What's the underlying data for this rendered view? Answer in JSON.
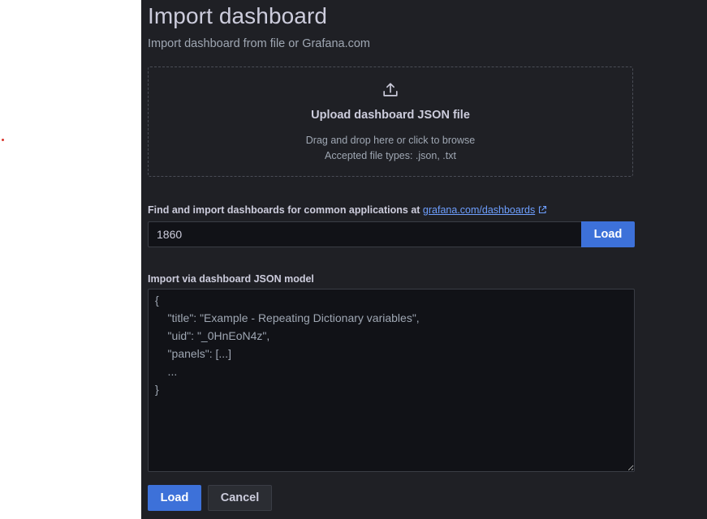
{
  "page": {
    "title": "Import dashboard",
    "subtitle": "Import dashboard from file or Grafana.com"
  },
  "upload": {
    "icon": "upload-icon",
    "title": "Upload dashboard JSON file",
    "hint": "Drag and drop here or click to browse",
    "accepted_types": "Accepted file types: .json, .txt"
  },
  "grafana_com": {
    "label": "Find and import dashboards for common applications at ",
    "link_text": "grafana.com/dashboards",
    "link_icon": "external-link-icon",
    "input_value": "1860",
    "load_label": "Load"
  },
  "json_model": {
    "label": "Import via dashboard JSON model",
    "placeholder_lines": [
      "{",
      "    \"title\": \"Example - Repeating Dictionary variables\",",
      "    \"uid\": \"_0HnEoN4z\",",
      "    \"panels\": [...]",
      "    ...",
      "}"
    ]
  },
  "actions": {
    "load_label": "Load",
    "cancel_label": "Cancel"
  },
  "colors": {
    "background": "#1f2025",
    "primary": "#3d71d9",
    "link": "#6e9fff"
  }
}
